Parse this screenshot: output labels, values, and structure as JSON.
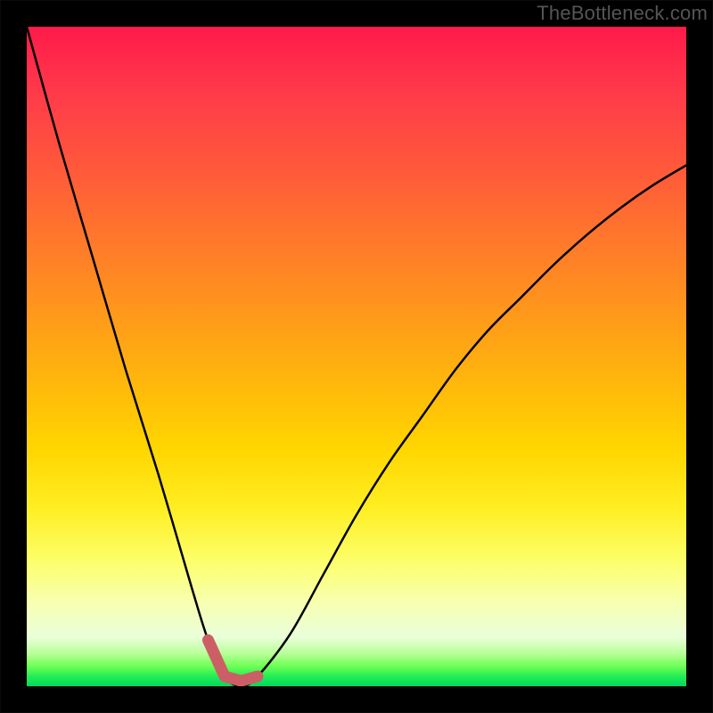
{
  "watermark": "TheBottleneck.com",
  "colors": {
    "curve": "#000000",
    "marker": "#cc5f66",
    "background_black": "#000000"
  },
  "chart_data": {
    "type": "line",
    "title": "",
    "xlabel": "",
    "ylabel": "",
    "xlim": [
      0,
      100
    ],
    "ylim": [
      0,
      100
    ],
    "grid": false,
    "series": [
      {
        "name": "bottleneck-curve",
        "x": [
          0,
          5,
          10,
          15,
          20,
          25,
          27.5,
          30,
          32.5,
          35,
          40,
          45,
          50,
          55,
          60,
          65,
          70,
          75,
          80,
          85,
          90,
          95,
          100
        ],
        "values": [
          100,
          82,
          65,
          48,
          32,
          15,
          7,
          1.5,
          0,
          1.5,
          8,
          17,
          26,
          34,
          41,
          48,
          54,
          59,
          64,
          68.5,
          72.5,
          76,
          79
        ]
      }
    ],
    "annotations": [
      {
        "name": "valley-marker",
        "shape": "v",
        "color": "#cc5f66",
        "x_range": [
          27,
          38
        ],
        "y_min": 0
      }
    ]
  }
}
